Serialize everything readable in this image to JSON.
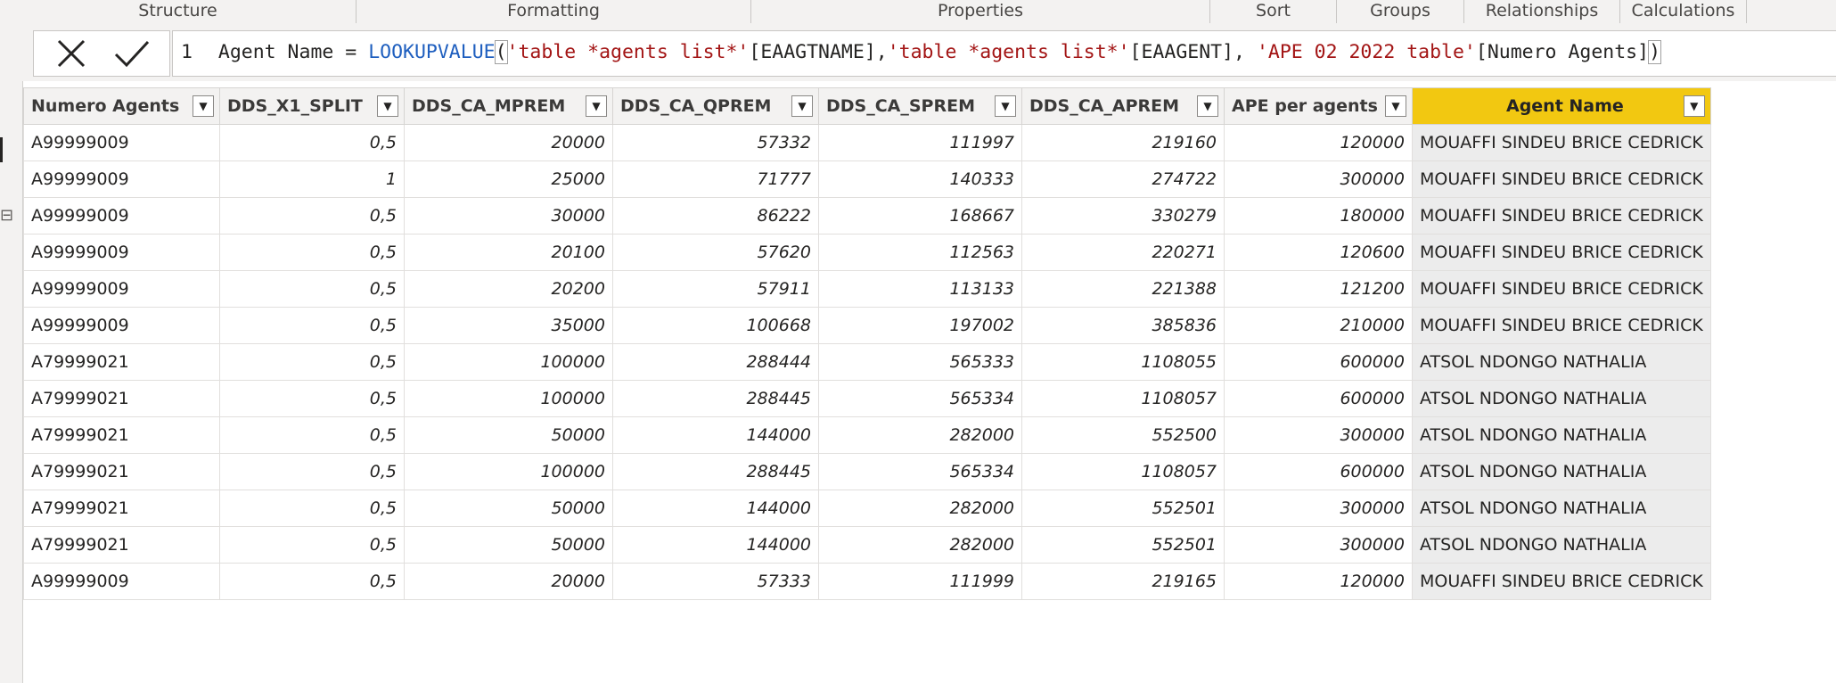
{
  "ribbon": {
    "groups": [
      "Structure",
      "Formatting",
      "Properties",
      "Sort",
      "Groups",
      "Relationships",
      "Calculations"
    ]
  },
  "formula": {
    "line_number": "1",
    "column_name": "Agent Name",
    "operator": "=",
    "function": "LOOKUPVALUE",
    "arg1": "'table *agents list*'",
    "arg1_col": "[EAAGTNAME]",
    "arg2": "'table *agents list*'",
    "arg2_col": "[EAAGENT]",
    "arg3": "'APE 02 2022 table'",
    "arg3_col": "[Numero Agents]"
  },
  "icons": {
    "cancel": "close-icon",
    "commit": "check-icon",
    "filter": "chevron-down-icon"
  },
  "table": {
    "headers": [
      "Numero Agents",
      "DDS_X1_SPLIT",
      "DDS_CA_MPREM",
      "DDS_CA_QPREM",
      "DDS_CA_SPREM",
      "DDS_CA_APREM",
      "APE per agents",
      "Agent Name"
    ],
    "rows": [
      [
        "A99999009",
        "0,5",
        "20000",
        "57332",
        "111997",
        "219160",
        "120000",
        "MOUAFFI SINDEU BRICE CEDRICK"
      ],
      [
        "A99999009",
        "1",
        "25000",
        "71777",
        "140333",
        "274722",
        "300000",
        "MOUAFFI SINDEU BRICE CEDRICK"
      ],
      [
        "A99999009",
        "0,5",
        "30000",
        "86222",
        "168667",
        "330279",
        "180000",
        "MOUAFFI SINDEU BRICE CEDRICK"
      ],
      [
        "A99999009",
        "0,5",
        "20100",
        "57620",
        "112563",
        "220271",
        "120600",
        "MOUAFFI SINDEU BRICE CEDRICK"
      ],
      [
        "A99999009",
        "0,5",
        "20200",
        "57911",
        "113133",
        "221388",
        "121200",
        "MOUAFFI SINDEU BRICE CEDRICK"
      ],
      [
        "A99999009",
        "0,5",
        "35000",
        "100668",
        "197002",
        "385836",
        "210000",
        "MOUAFFI SINDEU BRICE CEDRICK"
      ],
      [
        "A79999021",
        "0,5",
        "100000",
        "288444",
        "565333",
        "1108055",
        "600000",
        "ATSOL NDONGO NATHALIA"
      ],
      [
        "A79999021",
        "0,5",
        "100000",
        "288445",
        "565334",
        "1108057",
        "600000",
        "ATSOL NDONGO NATHALIA"
      ],
      [
        "A79999021",
        "0,5",
        "50000",
        "144000",
        "282000",
        "552500",
        "300000",
        "ATSOL NDONGO NATHALIA"
      ],
      [
        "A79999021",
        "0,5",
        "100000",
        "288445",
        "565334",
        "1108057",
        "600000",
        "ATSOL NDONGO NATHALIA"
      ],
      [
        "A79999021",
        "0,5",
        "50000",
        "144000",
        "282000",
        "552501",
        "300000",
        "ATSOL NDONGO NATHALIA"
      ],
      [
        "A79999021",
        "0,5",
        "50000",
        "144000",
        "282000",
        "552501",
        "300000",
        "ATSOL NDONGO NATHALIA"
      ],
      [
        "A99999009",
        "0,5",
        "20000",
        "57333",
        "111999",
        "219165",
        "120000",
        "MOUAFFI SINDEU BRICE CEDRICK"
      ]
    ]
  },
  "colors": {
    "selected_header": "#f2c811",
    "selected_column": "#ececec",
    "function_blue": "#1f5fbf",
    "string_red": "#a31515"
  }
}
